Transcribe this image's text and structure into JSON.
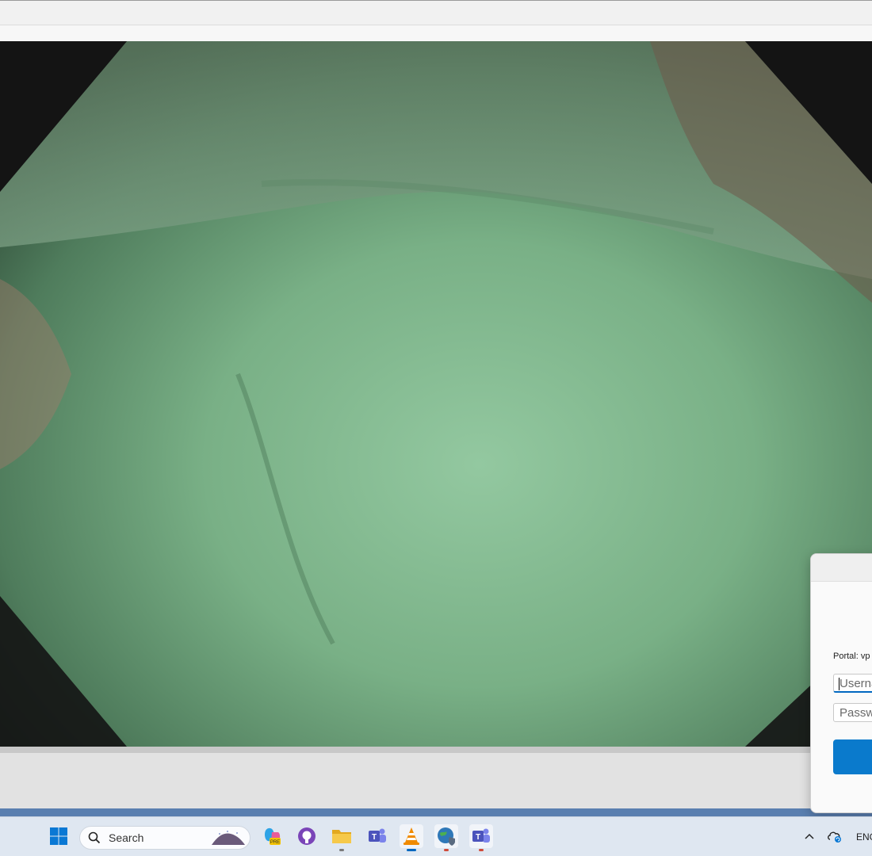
{
  "dialog": {
    "portal_label": "Portal: vp",
    "username_placeholder": "Userna",
    "password_placeholder": "Passwo"
  },
  "taskbar": {
    "search_label": "Search",
    "language": "ENG",
    "apps": [
      "start-button",
      "copilot-app",
      "github-desktop-app",
      "file-explorer-app",
      "teams-classic-app",
      "vlc-app",
      "vpn-globe-app",
      "teams-app"
    ]
  },
  "colors": {
    "accent": "#0067c0",
    "connect_button": "#0a7acc",
    "video_tint": "#7ab28a"
  }
}
